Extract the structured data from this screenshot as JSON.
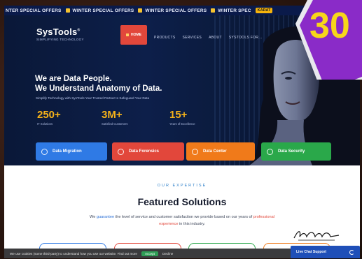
{
  "promo_bar": {
    "items": [
      "NTER SPECIAL OFFERS",
      "WINTER SPECIAL OFFERS",
      "WINTER SPECIAL OFFERS",
      "WINTER SPEC"
    ],
    "badge": "KARAT"
  },
  "logo": {
    "name": "SysTools",
    "reg": "®",
    "tagline": "SIMPLIFYING TECHNOLOGY"
  },
  "nav": {
    "home": "HOME",
    "links": [
      "PRODUCTS",
      "SERVICES",
      "ABOUT",
      "SYSTOOLS FOR..."
    ]
  },
  "hero": {
    "title_line1": "We are Data People.",
    "title_line2": "We Understand Anatomy of Data.",
    "subtitle": "Simplify Technology with SysTools Your Trusted Partner to Safeguard Your Data",
    "stats": [
      {
        "value": "250+",
        "label": "IT Solutions"
      },
      {
        "value": "3M+",
        "label": "Satisfied Customers"
      },
      {
        "value": "15+",
        "label": "Years of Excellence"
      }
    ],
    "ctas": [
      {
        "label": "Data Migration",
        "color": "#2f7ae5"
      },
      {
        "label": "Data Forensics",
        "color": "#e2473b"
      },
      {
        "label": "Data Center",
        "color": "#f07a1a"
      },
      {
        "label": "Data Security",
        "color": "#2aa84a"
      }
    ]
  },
  "overlay_badge": {
    "text": "30"
  },
  "expertise": {
    "eyebrow": "OUR EXPERTISE",
    "title": "Featured Solutions",
    "desc_prefix": "We ",
    "desc_highlight": "guarantee",
    "desc_middle": " the level of service and customer satisfaction we provide based on our years of ",
    "desc_highlight2": "professional experience",
    "desc_suffix": " in this industry.",
    "signature": "Let's talk"
  },
  "cards": [
    {
      "border": "#2f7ae5"
    },
    {
      "border": "#e2473b"
    },
    {
      "border": "#2aa84a"
    },
    {
      "border": "#f07a1a"
    }
  ],
  "cookie": {
    "text": "We use cookies (some third-party) to understand how you use our website. Find out more",
    "accept": "Accept",
    "decline": "Decline"
  },
  "support": {
    "label": "Live Chat Support"
  }
}
